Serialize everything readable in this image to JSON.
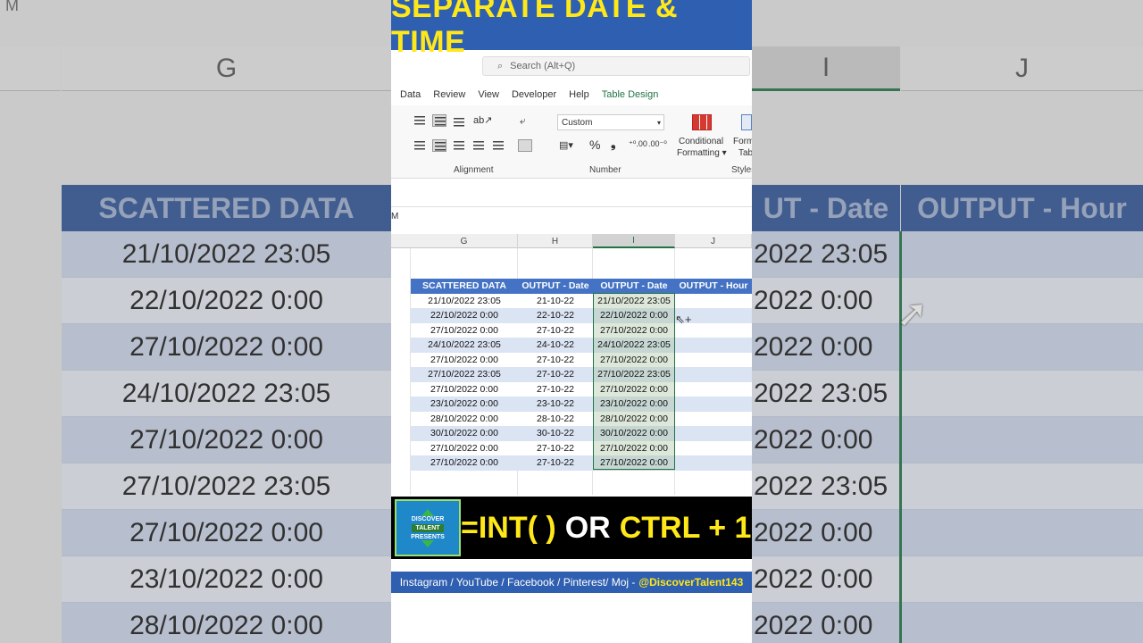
{
  "title": "SEPARATE DATE & TIME",
  "search": {
    "placeholder": "Search (Alt+Q)"
  },
  "tabs": [
    "Data",
    "Review",
    "View",
    "Developer",
    "Help",
    "Table Design"
  ],
  "ribbon": {
    "alignment_label": "Alignment",
    "number_label": "Number",
    "styles_label": "Styles",
    "number_format": "Custom",
    "conditional_formatting": "Conditional",
    "conditional_formatting2": "Formatting",
    "format_table": "Form",
    "format_table2": "Tab",
    "currency_symbol": "%",
    "comma_symbol": "❟"
  },
  "namebox": "M",
  "columns": [
    "G",
    "H",
    "I",
    "J"
  ],
  "table": {
    "headers": [
      "SCATTERED DATA",
      "OUTPUT - Date",
      "OUTPUT - Date",
      "OUTPUT - Hour"
    ],
    "rows": [
      [
        "21/10/2022 23:05",
        "21-10-22",
        "21/10/2022 23:05",
        ""
      ],
      [
        "22/10/2022 0:00",
        "22-10-22",
        "22/10/2022 0:00",
        ""
      ],
      [
        "27/10/2022 0:00",
        "27-10-22",
        "27/10/2022 0:00",
        ""
      ],
      [
        "24/10/2022 23:05",
        "24-10-22",
        "24/10/2022 23:05",
        ""
      ],
      [
        "27/10/2022 0:00",
        "27-10-22",
        "27/10/2022 0:00",
        ""
      ],
      [
        "27/10/2022 23:05",
        "27-10-22",
        "27/10/2022 23:05",
        ""
      ],
      [
        "27/10/2022 0:00",
        "27-10-22",
        "27/10/2022 0:00",
        ""
      ],
      [
        "23/10/2022 0:00",
        "23-10-22",
        "23/10/2022 0:00",
        ""
      ],
      [
        "28/10/2022 0:00",
        "28-10-22",
        "28/10/2022 0:00",
        ""
      ],
      [
        "30/10/2022 0:00",
        "30-10-22",
        "30/10/2022 0:00",
        ""
      ],
      [
        "27/10/2022 0:00",
        "27-10-22",
        "27/10/2022 0:00",
        ""
      ],
      [
        "27/10/2022 0:00",
        "27-10-22",
        "27/10/2022 0:00",
        ""
      ]
    ]
  },
  "logo": {
    "line1": "DISCOVER",
    "line2": "TALENT",
    "line3": "PRESENTS"
  },
  "banner": {
    "part1": "=INT( ) ",
    "part2": "OR ",
    "part3": "CTRL + 1"
  },
  "social": {
    "text": "Instagram / YouTube / Facebook / Pinterest/ Moj - ",
    "handle": "@DiscoverTalent143"
  },
  "background": {
    "left_col": "G",
    "right_col_i": "I",
    "right_col_j": "J",
    "left_header": "SCATTERED DATA",
    "right_header_date": "UT - Date",
    "right_header_hour": "OUTPUT - Hour",
    "left_rows": [
      "21/10/2022 23:05",
      "22/10/2022 0:00",
      "27/10/2022 0:00",
      "24/10/2022 23:05",
      "27/10/2022 0:00",
      "27/10/2022 23:05",
      "27/10/2022 0:00",
      "23/10/2022 0:00",
      "28/10/2022 0:00"
    ],
    "right_rows": [
      "2022 23:05",
      "2022 0:00",
      "2022 0:00",
      "2022 23:05",
      "2022 0:00",
      "2022 23:05",
      "2022 0:00",
      "2022 0:00",
      "2022 0:00"
    ],
    "corner": "M"
  },
  "colors": {
    "brand_blue": "#2f5fb0",
    "accent_yellow": "#ffe81a",
    "table_header": "#4472c4",
    "excel_green": "#217346"
  }
}
